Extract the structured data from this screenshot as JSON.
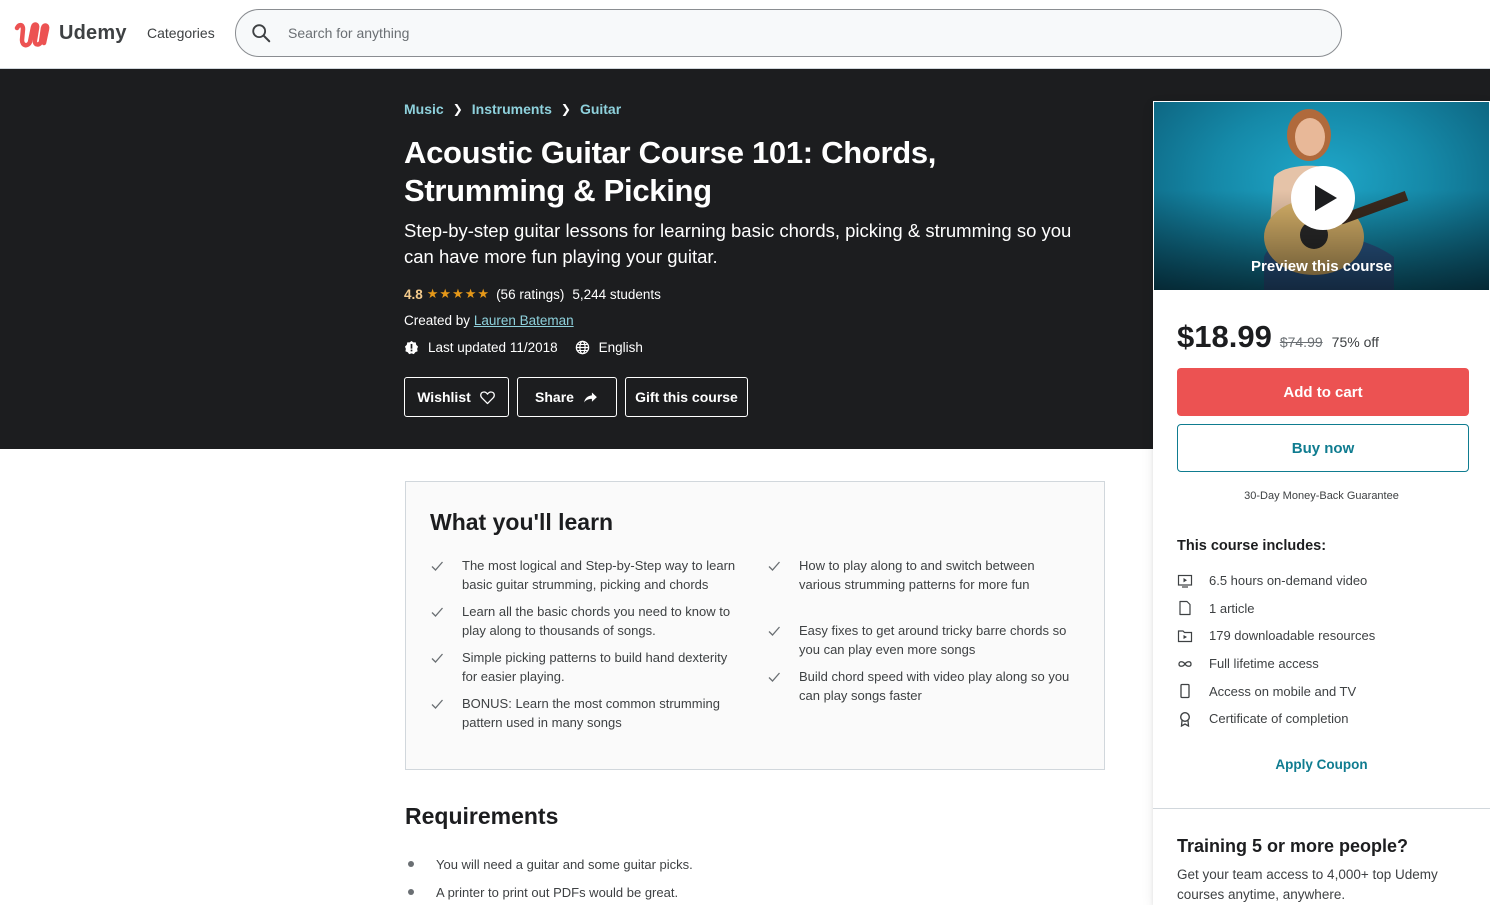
{
  "header": {
    "brand": "Udemy",
    "categories_label": "Categories",
    "search_placeholder": "Search for anything",
    "brand_color": "#ec5252"
  },
  "course": {
    "breadcrumb": [
      "Music",
      "Instruments",
      "Guitar"
    ],
    "title": "Acoustic Guitar Course 101: Chords, Strumming & Picking",
    "subtitle": "Step-by-step guitar lessons for learning basic chords, picking & strumming so you can have more fun playing your guitar.",
    "rating": "4.8",
    "stars": "★★★★★",
    "rating_count": "(56 ratings)",
    "students": "5,244 students",
    "created_by_label": "Created by",
    "instructor": "Lauren Bateman",
    "last_updated": "Last updated 11/2018",
    "language": "English",
    "actions": {
      "wishlist": "Wishlist",
      "share": "Share",
      "gift": "Gift this course"
    }
  },
  "sidebar": {
    "preview_label": "Preview this course",
    "price": "$18.99",
    "original_price": "$74.99",
    "discount": "75% off",
    "add_to_cart": "Add to cart",
    "buy_now": "Buy now",
    "guarantee": "30-Day Money-Back Guarantee",
    "includes_title": "This course includes:",
    "includes": [
      {
        "icon": "video-icon",
        "text": "6.5 hours on-demand video"
      },
      {
        "icon": "article-icon",
        "text": "1 article"
      },
      {
        "icon": "folder-download-icon",
        "text": "179 downloadable resources"
      },
      {
        "icon": "infinity-icon",
        "text": "Full lifetime access"
      },
      {
        "icon": "mobile-icon",
        "text": "Access on mobile and TV"
      },
      {
        "icon": "certificate-icon",
        "text": "Certificate of completion"
      }
    ],
    "apply_coupon": "Apply Coupon",
    "training_title": "Training 5 or more people?",
    "training_text": "Get your team access to 4,000+ top Udemy courses anytime, anywhere.",
    "cart_color": "#ec5252",
    "accent_color": "#0f7c90"
  },
  "learn": {
    "title": "What you'll learn",
    "left": [
      "The most logical and Step-by-Step way to learn basic guitar strumming, picking and chords",
      "Learn all the basic chords you need to know to play along to thousands of songs.",
      "Simple picking patterns to build hand dexterity for easier playing.",
      "BONUS: Learn the most common strumming pattern used in many songs"
    ],
    "right": [
      "How to play along to and switch between various strumming patterns for more fun",
      "Easy fixes to get around tricky barre chords so you can play even more songs",
      "Build chord speed with video play along so you can play songs faster"
    ]
  },
  "requirements": {
    "title": "Requirements",
    "items": [
      "You will need a guitar and some guitar picks.",
      "A printer to print out PDFs would be great."
    ]
  }
}
